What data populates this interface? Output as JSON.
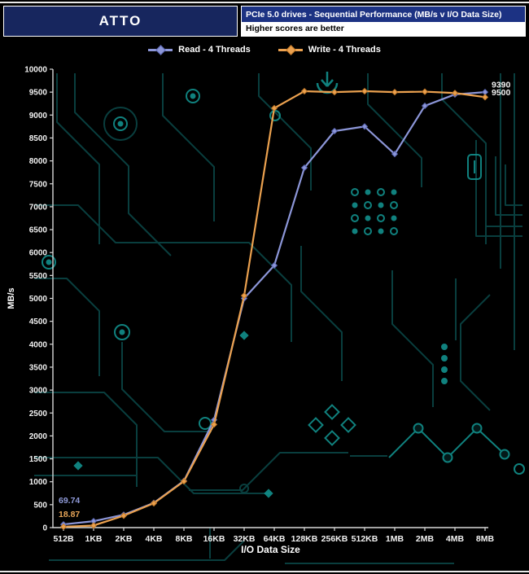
{
  "header": {
    "app": "ATTO",
    "title": "PCIe 5.0 drives - Sequential Performance (MB/s v I/O Data Size)",
    "note": "Higher scores are better",
    "app_bg": "#17265e",
    "title_bg": "#1c3283"
  },
  "legend": {
    "read_label": "Read - 4 Threads",
    "write_label": "Write - 4 Threads"
  },
  "colors": {
    "read": "#8c96d8",
    "write": "#eba14f",
    "axis": "#d9d9d9",
    "circuit_dim": "#0b4545",
    "circuit_bright": "#12908c"
  },
  "chart_data": {
    "type": "line",
    "title": "PCIe 5.0 drives - Sequential Performance (MB/s v I/O Data Size)",
    "xlabel": "I/O Data Size",
    "ylabel": "MB/s",
    "categories": [
      "512B",
      "1KB",
      "2KB",
      "4KB",
      "8KB",
      "16KB",
      "32KB",
      "64KB",
      "128KB",
      "256KB",
      "512KB",
      "1MB",
      "2MB",
      "4MB",
      "8MB"
    ],
    "series": [
      {
        "name": "Read - 4 Threads",
        "color": "#8c96d8",
        "edge": "#5a66b0",
        "values": [
          69.74,
          140,
          280,
          540,
          1020,
          2350,
          5000,
          5720,
          7850,
          8650,
          8750,
          8150,
          9200,
          9450,
          9500
        ]
      },
      {
        "name": "Write - 4 Threads",
        "color": "#eba14f",
        "edge": "#c07828",
        "values": [
          18.87,
          45,
          260,
          530,
          1010,
          2250,
          5060,
          9150,
          9520,
          9500,
          9520,
          9500,
          9510,
          9480,
          9390
        ]
      }
    ],
    "ylim": [
      0,
      10000
    ],
    "y_ticks": [
      0,
      500,
      1000,
      1500,
      2000,
      2500,
      3000,
      3500,
      4000,
      4500,
      5000,
      5500,
      6000,
      6500,
      7000,
      7500,
      8000,
      8500,
      9000,
      9500,
      10000
    ],
    "grid": false,
    "legend_position": "top",
    "marker": "diamond",
    "annotations": [
      {
        "text": "69.74",
        "color": "#8f9ad9",
        "series": 0,
        "point": 0,
        "dx": -6,
        "dy": -26,
        "anchor": "start"
      },
      {
        "text": "18.87",
        "color": "#e8a558",
        "series": 1,
        "point": 0,
        "dx": -6,
        "dy": -12,
        "anchor": "start"
      },
      {
        "text": "9390",
        "color": "#f2f2f2",
        "series": 1,
        "point": 14,
        "dx": 8,
        "dy": -12,
        "anchor": "start"
      },
      {
        "text": "9500",
        "color": "#f2f2f2",
        "series": 0,
        "point": 14,
        "dx": 8,
        "dy": 4,
        "anchor": "start"
      }
    ]
  }
}
